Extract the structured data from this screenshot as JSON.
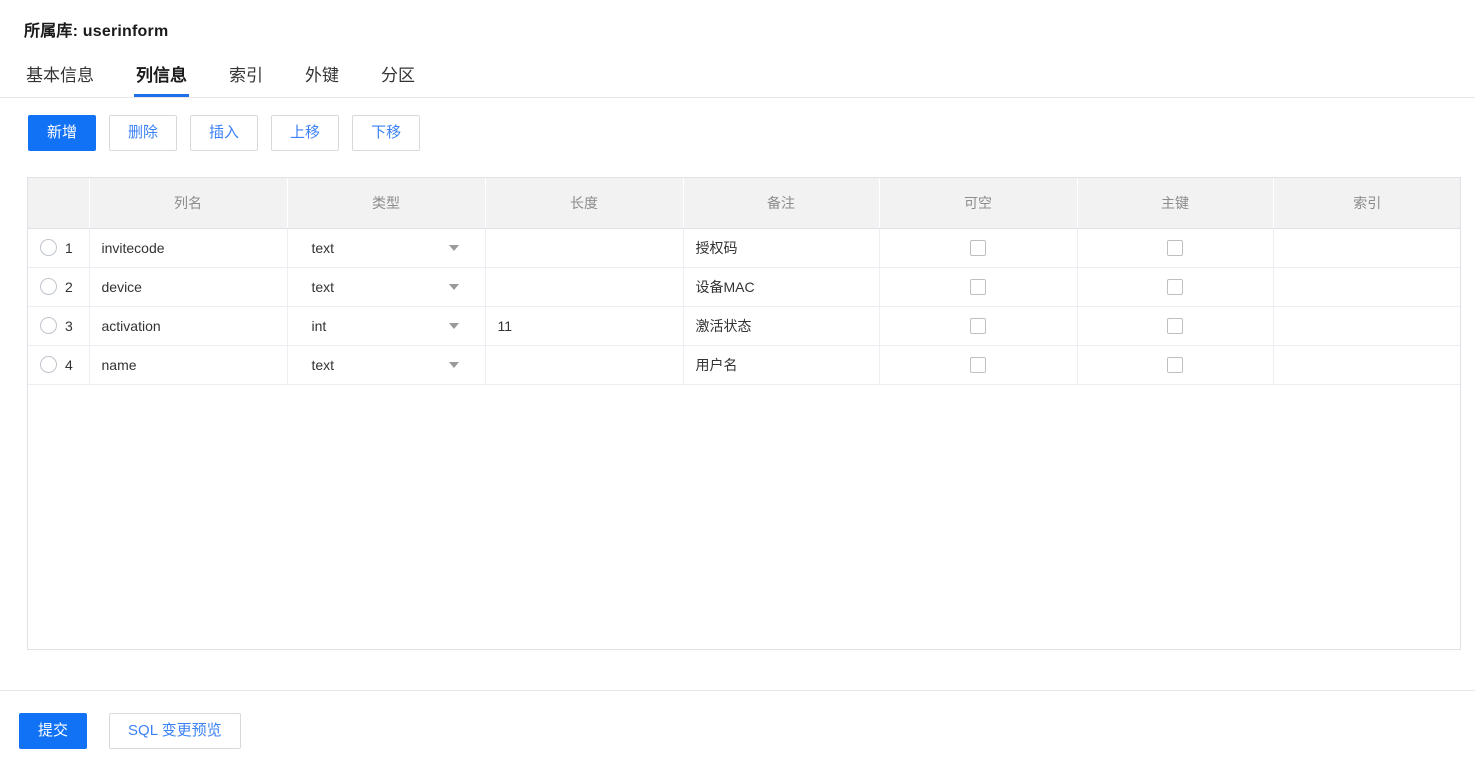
{
  "header": {
    "label": "所属库:",
    "database": "userinform"
  },
  "tabs": [
    {
      "label": "基本信息",
      "active": false
    },
    {
      "label": "列信息",
      "active": true
    },
    {
      "label": "索引",
      "active": false
    },
    {
      "label": "外键",
      "active": false
    },
    {
      "label": "分区",
      "active": false
    }
  ],
  "toolbar": {
    "add_label": "新增",
    "delete_label": "删除",
    "insert_label": "插入",
    "move_up_label": "上移",
    "move_down_label": "下移"
  },
  "table": {
    "columns": [
      "",
      "列名",
      "类型",
      "长度",
      "备注",
      "可空",
      "主键",
      "索引"
    ],
    "rows": [
      {
        "index": "1",
        "selected": false,
        "name": "invitecode",
        "type": "text",
        "length": "",
        "comment": "授权码",
        "nullable": false,
        "primary_key": false,
        "indexed": false
      },
      {
        "index": "2",
        "selected": false,
        "name": "device",
        "type": "text",
        "length": "",
        "comment": "设备MAC",
        "nullable": false,
        "primary_key": false,
        "indexed": false
      },
      {
        "index": "3",
        "selected": false,
        "name": "activation",
        "type": "int",
        "length": "11",
        "comment": "激活状态",
        "nullable": false,
        "primary_key": false,
        "indexed": false
      },
      {
        "index": "4",
        "selected": false,
        "name": "name",
        "type": "text",
        "length": "",
        "comment": "用户名",
        "nullable": false,
        "primary_key": false,
        "indexed": false
      }
    ]
  },
  "footer": {
    "submit_label": "提交",
    "preview_label": "SQL 变更预览"
  },
  "colors": {
    "primary": "#1272f5",
    "link": "#3b82f6",
    "tab_active_underline": "#1f6feb",
    "header_bg": "#f2f2f2",
    "border": "#dfe3e8"
  }
}
